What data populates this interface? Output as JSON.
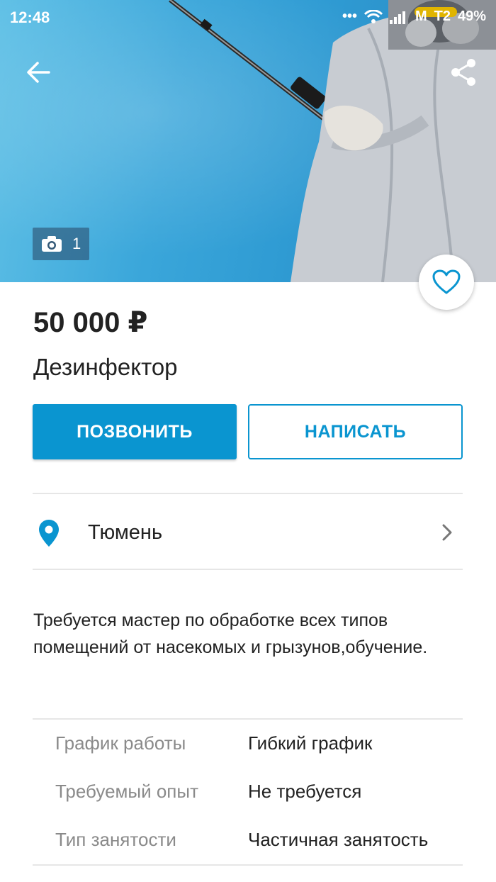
{
  "status_bar": {
    "time": "12:48",
    "carrier_label": "M",
    "network_label": "T2",
    "battery": "49%"
  },
  "hero": {
    "photo_count": "1"
  },
  "listing": {
    "price": "50 000 ₽",
    "title": "Дезинфектор"
  },
  "actions": {
    "call_label": "ПОЗВОНИТЬ",
    "write_label": "НАПИСАТЬ"
  },
  "location": {
    "city": "Тюмень"
  },
  "description": "Требуется мастер по обработке всех типов помещений от насекомых и грызунов,обучение.",
  "params": [
    {
      "label": "График работы",
      "value": "Гибкий график"
    },
    {
      "label": "Требуемый опыт",
      "value": "Не требуется"
    },
    {
      "label": "Тип занятости",
      "value": "Частичная занятость"
    }
  ],
  "colors": {
    "accent": "#0a95d0",
    "pin": "#0a95d0",
    "secondary_text": "#8a8a8a",
    "divider": "#e6e6e6"
  },
  "icons": [
    "back-arrow-icon",
    "share-icon",
    "camera-icon",
    "heart-icon",
    "location-pin-icon",
    "chevron-right-icon",
    "wifi-icon",
    "signal-icon"
  ]
}
